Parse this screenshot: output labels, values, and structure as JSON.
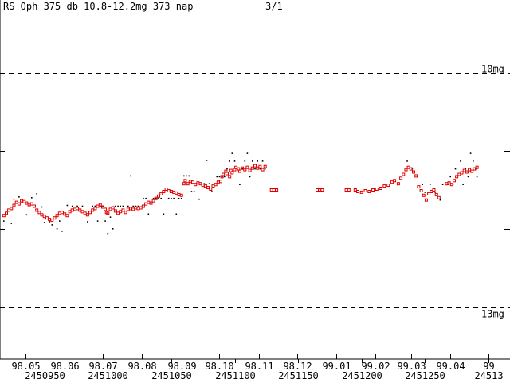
{
  "header": {
    "title": "RS  Oph 375 db 10.8-12.2mg 373 nap",
    "page": "3/1"
  },
  "chart_data": {
    "type": "scatter",
    "title": "RS  Oph 375 db 10.8-12.2mg 373 nap",
    "xlabel": "",
    "ylabel": "",
    "xlim": [
      2450915,
      2451317
    ],
    "ylim": [
      13.05,
      9.55
    ],
    "y_inverted": true,
    "dashed_reference_lines": [
      {
        "value": 10.0,
        "label": "10mg"
      },
      {
        "value": 13.0,
        "label": "13mg"
      }
    ],
    "solid_y_ticks": [
      11.0,
      12.0
    ],
    "x_month_ticks": [
      {
        "jd": 2450935,
        "label": "98.05"
      },
      {
        "jd": 2450966,
        "label": "98.06"
      },
      {
        "jd": 2450996,
        "label": "98.07"
      },
      {
        "jd": 2451027,
        "label": "98.08"
      },
      {
        "jd": 2451058,
        "label": "98.09"
      },
      {
        "jd": 2451088,
        "label": "98.10"
      },
      {
        "jd": 2451119,
        "label": "98.11"
      },
      {
        "jd": 2451149,
        "label": "98.12"
      },
      {
        "jd": 2451180,
        "label": "99.01"
      },
      {
        "jd": 2451211,
        "label": "99.02"
      },
      {
        "jd": 2451239,
        "label": "99.03"
      },
      {
        "jd": 2451270,
        "label": "99.04"
      },
      {
        "jd": 2451300,
        "label": "99"
      }
    ],
    "x_jd_ticks": [
      {
        "jd": 2450950,
        "label": "2450950"
      },
      {
        "jd": 2451000,
        "label": "2451000"
      },
      {
        "jd": 2451050,
        "label": "2451050"
      },
      {
        "jd": 2451100,
        "label": "2451100"
      },
      {
        "jd": 2451150,
        "label": "2451150"
      },
      {
        "jd": 2451200,
        "label": "2451200"
      },
      {
        "jd": 2451250,
        "label": "2451250"
      },
      {
        "jd": 2451300,
        "label": "24513"
      }
    ],
    "series": [
      {
        "marker": "square",
        "color": "#e00000",
        "points": [
          [
            2450918,
            11.83
          ],
          [
            2450920,
            11.8
          ],
          [
            2450922,
            11.76
          ],
          [
            2450924,
            11.74
          ],
          [
            2450926,
            11.7
          ],
          [
            2450928,
            11.66
          ],
          [
            2450930,
            11.68
          ],
          [
            2450932,
            11.64
          ],
          [
            2450934,
            11.65
          ],
          [
            2450936,
            11.67
          ],
          [
            2450938,
            11.69
          ],
          [
            2450940,
            11.68
          ],
          [
            2450942,
            11.71
          ],
          [
            2450944,
            11.76
          ],
          [
            2450946,
            11.79
          ],
          [
            2450948,
            11.82
          ],
          [
            2450950,
            11.84
          ],
          [
            2450952,
            11.86
          ],
          [
            2450954,
            11.88
          ],
          [
            2450956,
            11.89
          ],
          [
            2450958,
            11.86
          ],
          [
            2450960,
            11.83
          ],
          [
            2450962,
            11.8
          ],
          [
            2450964,
            11.79
          ],
          [
            2450966,
            11.81
          ],
          [
            2450968,
            11.83
          ],
          [
            2450970,
            11.78
          ],
          [
            2450972,
            11.76
          ],
          [
            2450974,
            11.75
          ],
          [
            2450976,
            11.74
          ],
          [
            2450978,
            11.76
          ],
          [
            2450980,
            11.78
          ],
          [
            2450982,
            11.8
          ],
          [
            2450984,
            11.82
          ],
          [
            2450986,
            11.79
          ],
          [
            2450988,
            11.76
          ],
          [
            2450990,
            11.74
          ],
          [
            2450992,
            11.71
          ],
          [
            2450994,
            11.69
          ],
          [
            2450996,
            11.72
          ],
          [
            2450998,
            11.75
          ],
          [
            2450999,
            11.79
          ],
          [
            2451000,
            11.8
          ],
          [
            2451002,
            11.75
          ],
          [
            2451004,
            11.73
          ],
          [
            2451006,
            11.77
          ],
          [
            2451008,
            11.8
          ],
          [
            2451010,
            11.78
          ],
          [
            2451012,
            11.76
          ],
          [
            2451014,
            11.79
          ],
          [
            2451016,
            11.75
          ],
          [
            2451018,
            11.74
          ],
          [
            2451020,
            11.75
          ],
          [
            2451022,
            11.73
          ],
          [
            2451024,
            11.74
          ],
          [
            2451026,
            11.73
          ],
          [
            2451028,
            11.71
          ],
          [
            2451030,
            11.68
          ],
          [
            2451032,
            11.66
          ],
          [
            2451034,
            11.67
          ],
          [
            2451036,
            11.64
          ],
          [
            2451038,
            11.61
          ],
          [
            2451040,
            11.58
          ],
          [
            2451042,
            11.55
          ],
          [
            2451044,
            11.52
          ],
          [
            2451046,
            11.49
          ],
          [
            2451048,
            11.51
          ],
          [
            2451050,
            11.52
          ],
          [
            2451052,
            11.53
          ],
          [
            2451054,
            11.54
          ],
          [
            2451056,
            11.56
          ],
          [
            2451058,
            11.57
          ],
          [
            2451060,
            11.42
          ],
          [
            2451061,
            11.38
          ],
          [
            2451063,
            11.42
          ],
          [
            2451065,
            11.39
          ],
          [
            2451067,
            11.4
          ],
          [
            2451069,
            11.43
          ],
          [
            2451071,
            11.41
          ],
          [
            2451073,
            11.42
          ],
          [
            2451075,
            11.44
          ],
          [
            2451077,
            11.45
          ],
          [
            2451079,
            11.47
          ],
          [
            2451081,
            11.49
          ],
          [
            2451083,
            11.45
          ],
          [
            2451085,
            11.43
          ],
          [
            2451087,
            11.4
          ],
          [
            2451089,
            11.39
          ],
          [
            2451090,
            11.33
          ],
          [
            2451091,
            11.3
          ],
          [
            2451093,
            11.26
          ],
          [
            2451094,
            11.29
          ],
          [
            2451096,
            11.33
          ],
          [
            2451097,
            11.25
          ],
          [
            2451098,
            11.28
          ],
          [
            2451100,
            11.24
          ],
          [
            2451101,
            11.21
          ],
          [
            2451103,
            11.23
          ],
          [
            2451104,
            11.26
          ],
          [
            2451106,
            11.22
          ],
          [
            2451108,
            11.24
          ],
          [
            2451110,
            11.21
          ],
          [
            2451112,
            11.25
          ],
          [
            2451114,
            11.22
          ],
          [
            2451116,
            11.19
          ],
          [
            2451118,
            11.22
          ],
          [
            2451120,
            11.2
          ],
          [
            2451122,
            11.24
          ],
          [
            2451124,
            11.2
          ],
          [
            2451129,
            11.5
          ],
          [
            2451131,
            11.5
          ],
          [
            2451133,
            11.5
          ],
          [
            2451165,
            11.5
          ],
          [
            2451167,
            11.5
          ],
          [
            2451169,
            11.5
          ],
          [
            2451188,
            11.5
          ],
          [
            2451190,
            11.5
          ],
          [
            2451195,
            11.5
          ],
          [
            2451197,
            11.52
          ],
          [
            2451200,
            11.53
          ],
          [
            2451203,
            11.51
          ],
          [
            2451206,
            11.52
          ],
          [
            2451209,
            11.5
          ],
          [
            2451212,
            11.49
          ],
          [
            2451215,
            11.48
          ],
          [
            2451218,
            11.45
          ],
          [
            2451221,
            11.44
          ],
          [
            2451224,
            11.4
          ],
          [
            2451226,
            11.38
          ],
          [
            2451229,
            11.42
          ],
          [
            2451231,
            11.35
          ],
          [
            2451233,
            11.3
          ],
          [
            2451235,
            11.24
          ],
          [
            2451237,
            11.21
          ],
          [
            2451239,
            11.23
          ],
          [
            2451241,
            11.27
          ],
          [
            2451243,
            11.32
          ],
          [
            2451245,
            11.46
          ],
          [
            2451247,
            11.51
          ],
          [
            2451249,
            11.57
          ],
          [
            2451251,
            11.63
          ],
          [
            2451253,
            11.55
          ],
          [
            2451255,
            11.52
          ],
          [
            2451257,
            11.5
          ],
          [
            2451259,
            11.56
          ],
          [
            2451261,
            11.6
          ],
          [
            2451267,
            11.42
          ],
          [
            2451269,
            11.41
          ],
          [
            2451271,
            11.43
          ],
          [
            2451273,
            11.38
          ],
          [
            2451275,
            11.33
          ],
          [
            2451277,
            11.3
          ],
          [
            2451279,
            11.28
          ],
          [
            2451281,
            11.25
          ],
          [
            2451283,
            11.27
          ],
          [
            2451285,
            11.24
          ],
          [
            2451287,
            11.26
          ],
          [
            2451289,
            11.23
          ],
          [
            2451291,
            11.21
          ]
        ]
      },
      {
        "marker": "dot",
        "color": "#000000",
        "points": [
          [
            2450918,
            11.9
          ],
          [
            2450924,
            11.93
          ],
          [
            2450926,
            11.62
          ],
          [
            2450930,
            11.59
          ],
          [
            2450936,
            11.82
          ],
          [
            2450940,
            11.6
          ],
          [
            2450944,
            11.55
          ],
          [
            2450948,
            11.72
          ],
          [
            2450950,
            11.92
          ],
          [
            2450954,
            11.91
          ],
          [
            2450956,
            11.95
          ],
          [
            2450960,
            12.0
          ],
          [
            2450962,
            11.9
          ],
          [
            2450964,
            12.03
          ],
          [
            2450968,
            11.7
          ],
          [
            2450972,
            11.71
          ],
          [
            2450976,
            11.71
          ],
          [
            2450980,
            11.71
          ],
          [
            2450984,
            11.91
          ],
          [
            2450988,
            11.71
          ],
          [
            2450990,
            11.71
          ],
          [
            2450992,
            11.9
          ],
          [
            2450994,
            11.71
          ],
          [
            2450996,
            11.71
          ],
          [
            2450998,
            11.9
          ],
          [
            2451000,
            12.06
          ],
          [
            2451002,
            11.85
          ],
          [
            2451004,
            12.0
          ],
          [
            2451006,
            11.71
          ],
          [
            2451008,
            11.71
          ],
          [
            2451010,
            11.71
          ],
          [
            2451012,
            11.71
          ],
          [
            2451016,
            11.71
          ],
          [
            2451018,
            11.32
          ],
          [
            2451020,
            11.71
          ],
          [
            2451022,
            11.71
          ],
          [
            2451024,
            11.71
          ],
          [
            2451028,
            11.61
          ],
          [
            2451030,
            11.61
          ],
          [
            2451032,
            11.81
          ],
          [
            2451036,
            11.61
          ],
          [
            2451038,
            11.61
          ],
          [
            2451040,
            11.61
          ],
          [
            2451042,
            11.61
          ],
          [
            2451044,
            11.81
          ],
          [
            2451048,
            11.61
          ],
          [
            2451050,
            11.61
          ],
          [
            2451052,
            11.61
          ],
          [
            2451054,
            11.81
          ],
          [
            2451056,
            11.61
          ],
          [
            2451058,
            11.61
          ],
          [
            2451060,
            11.32
          ],
          [
            2451062,
            11.32
          ],
          [
            2451064,
            11.32
          ],
          [
            2451066,
            11.52
          ],
          [
            2451068,
            11.52
          ],
          [
            2451070,
            11.42
          ],
          [
            2451072,
            11.62
          ],
          [
            2451074,
            11.42
          ],
          [
            2451076,
            11.42
          ],
          [
            2451078,
            11.12
          ],
          [
            2451080,
            11.42
          ],
          [
            2451082,
            11.52
          ],
          [
            2451084,
            11.42
          ],
          [
            2451086,
            11.33
          ],
          [
            2451088,
            11.33
          ],
          [
            2451090,
            11.33
          ],
          [
            2451092,
            11.33
          ],
          [
            2451094,
            11.23
          ],
          [
            2451096,
            11.13
          ],
          [
            2451098,
            11.03
          ],
          [
            2451100,
            11.13
          ],
          [
            2451102,
            11.23
          ],
          [
            2451104,
            11.43
          ],
          [
            2451106,
            11.23
          ],
          [
            2451108,
            11.13
          ],
          [
            2451110,
            11.03
          ],
          [
            2451112,
            11.33
          ],
          [
            2451114,
            11.13
          ],
          [
            2451116,
            11.23
          ],
          [
            2451118,
            11.13
          ],
          [
            2451120,
            11.23
          ],
          [
            2451122,
            11.13
          ],
          [
            2451124,
            11.23
          ],
          [
            2451236,
            11.13
          ],
          [
            2451240,
            11.23
          ],
          [
            2451244,
            11.33
          ],
          [
            2451248,
            11.43
          ],
          [
            2451250,
            11.53
          ],
          [
            2451254,
            11.43
          ],
          [
            2451258,
            11.53
          ],
          [
            2451262,
            11.63
          ],
          [
            2451264,
            11.43
          ],
          [
            2451268,
            11.43
          ],
          [
            2451270,
            11.33
          ],
          [
            2451272,
            11.43
          ],
          [
            2451274,
            11.23
          ],
          [
            2451278,
            11.13
          ],
          [
            2451280,
            11.43
          ],
          [
            2451282,
            11.23
          ],
          [
            2451284,
            11.33
          ],
          [
            2451286,
            11.03
          ],
          [
            2451288,
            11.13
          ],
          [
            2451290,
            11.23
          ],
          [
            2451291,
            11.33
          ]
        ]
      }
    ]
  }
}
